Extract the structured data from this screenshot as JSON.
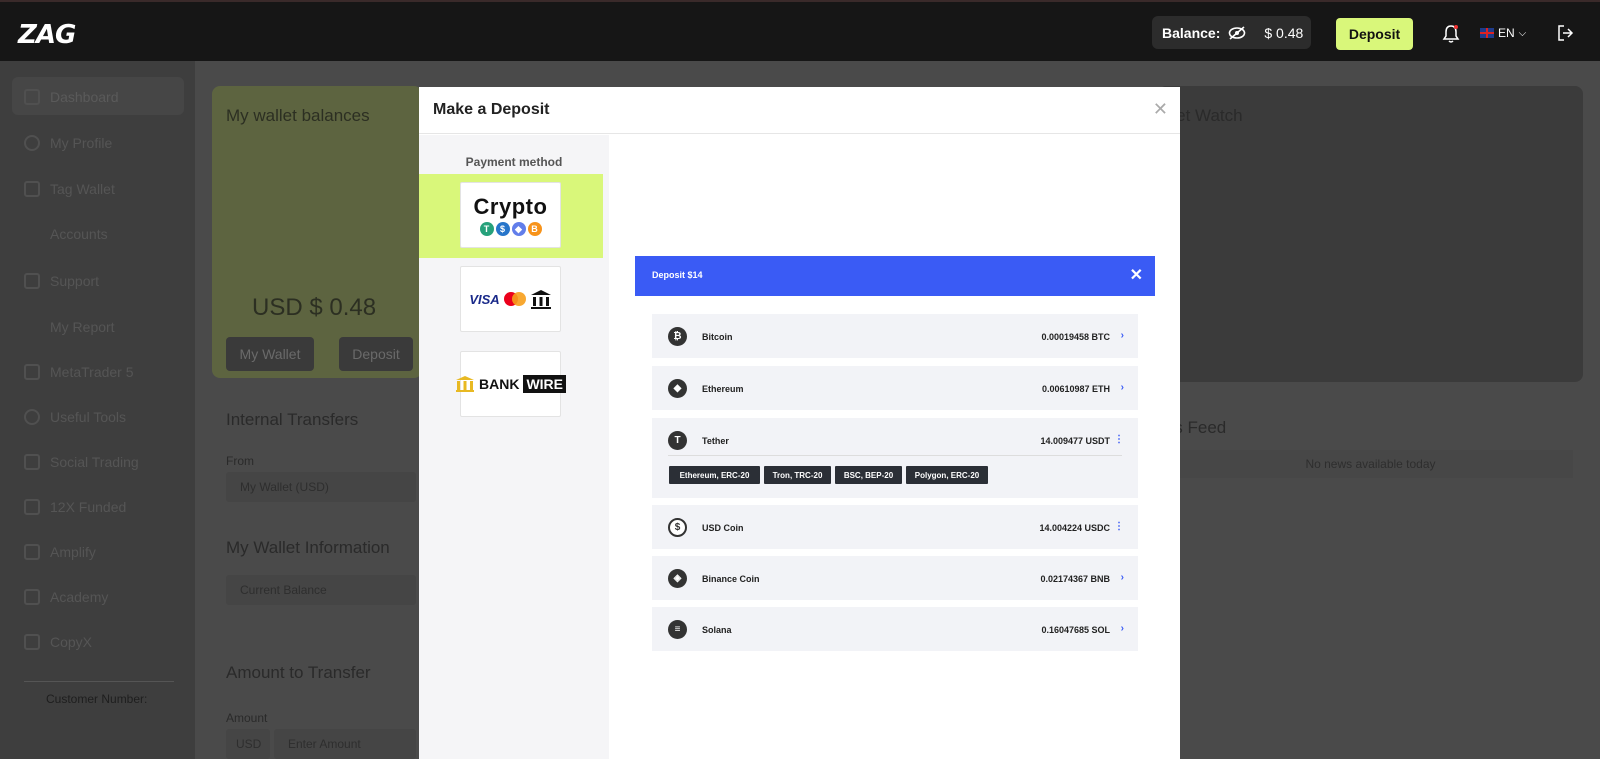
{
  "topbar": {
    "logo": "ZAG",
    "balance_label": "Balance:",
    "balance_value": "$ 0.48",
    "deposit_label": "Deposit",
    "language": "EN"
  },
  "sidebar": {
    "items": [
      {
        "label": "Dashboard",
        "icon": "dashboard-icon"
      },
      {
        "label": "My Profile",
        "icon": "user-icon"
      },
      {
        "label": "Tag Wallet",
        "icon": "wallet-icon"
      },
      {
        "label": "Accounts",
        "icon": "accounts-icon"
      },
      {
        "label": "Support",
        "icon": "mail-icon"
      },
      {
        "label": "My Report",
        "icon": "report-icon"
      },
      {
        "label": "MetaTrader 5",
        "icon": "metatrader-icon"
      },
      {
        "label": "Useful Tools",
        "icon": "tools-icon"
      },
      {
        "label": "Social Trading",
        "icon": "social-icon"
      },
      {
        "label": "12X Funded",
        "icon": "chart-icon"
      },
      {
        "label": "Amplify",
        "icon": "chart-icon"
      },
      {
        "label": "Academy",
        "icon": "chart-icon"
      },
      {
        "label": "CopyX",
        "icon": "chart-icon"
      }
    ],
    "customer_number_label": "Customer Number:"
  },
  "background": {
    "wallet_title": "My wallet balances",
    "wallet_balance": "USD $ 0.48",
    "my_wallet_btn": "My Wallet",
    "deposit_btn": "Deposit",
    "internal_transfers": "Internal Transfers",
    "from_label": "From",
    "from_value": "My Wallet (USD)",
    "wallet_info": "My Wallet Information",
    "current_balance": "Current Balance",
    "amount_to_transfer": "Amount to Transfer",
    "amount_label": "Amount",
    "currency": "USD",
    "amount_placeholder": "Enter Amount",
    "market_watch": "rket Watch",
    "news_feed": "ws Feed",
    "no_news": "No news available today"
  },
  "modal": {
    "title": "Make a Deposit",
    "payment_method_label": "Payment method",
    "methods": [
      {
        "name": "Crypto",
        "selected": true
      },
      {
        "name": "Cards & Bank",
        "selected": false
      },
      {
        "name": "Bank Wire",
        "selected": false
      }
    ],
    "crypto_logo_text": "Crypto",
    "visa_text": "VISA",
    "bank_text": "BANK",
    "wire_text": "WIRE",
    "deposit_header": "Deposit  $14",
    "coins": [
      {
        "name": "Bitcoin",
        "value": "0.00019458 BTC",
        "symbol": "₿",
        "indicator": "›"
      },
      {
        "name": "Ethereum",
        "value": "0.00610987 ETH",
        "symbol": "◆",
        "indicator": "›"
      },
      {
        "name": "Tether",
        "value": "14.009477 USDT",
        "symbol": "T",
        "indicator": "⋮",
        "networks": [
          "Ethereum, ERC-20",
          "Tron, TRC-20",
          "BSC, BEP-20",
          "Polygon, ERC-20"
        ]
      },
      {
        "name": "USD Coin",
        "value": "14.004224 USDC",
        "symbol": "$",
        "indicator": "⋮"
      },
      {
        "name": "Binance Coin",
        "value": "0.02174367 BNB",
        "symbol": "◈",
        "indicator": "›"
      },
      {
        "name": "Solana",
        "value": "0.16047685 SOL",
        "symbol": "≡",
        "indicator": "›"
      }
    ]
  },
  "colors": {
    "accent_green": "#d9f77a",
    "accent_blue": "#3a5bf5",
    "topbar": "#161616"
  }
}
